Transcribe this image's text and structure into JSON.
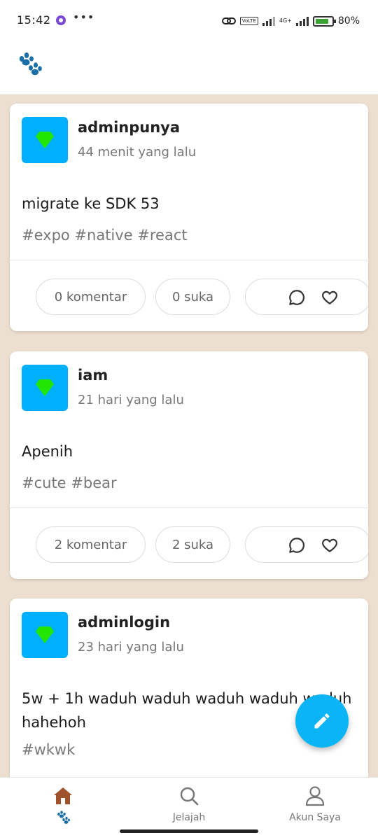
{
  "status_bar": {
    "time": "15:42",
    "more": "•••",
    "network": "4G+",
    "volte": "VoLTE",
    "battery": "80%"
  },
  "app_bar": {
    "logo_icon": "paw-icon",
    "brand_color": "#1b6fa8"
  },
  "posts": [
    {
      "username": "adminpunya",
      "time_ago": "44 menit yang lalu",
      "content": "migrate ke SDK 53",
      "tags": "#expo #native #react",
      "comments": "0 komentar",
      "likes": "0 suka"
    },
    {
      "username": "iam",
      "time_ago": "21 hari yang lalu",
      "content": "Apenih",
      "tags": "#cute #bear",
      "comments": "2 komentar",
      "likes": "2 suka"
    },
    {
      "username": "adminlogin",
      "time_ago": "23 hari yang lalu",
      "content": "5w + 1h waduh waduh waduh waduh waduh hahehoh",
      "tags": "#wkwk"
    }
  ],
  "fab": {
    "icon": "pencil-icon",
    "color": "#0ab4f5"
  },
  "tab_bar": {
    "tabs": [
      {
        "label": "",
        "icon": "home-icon",
        "active": true,
        "color": "#a0522d"
      },
      {
        "label": "Jelajah",
        "icon": "search-icon",
        "active": false
      },
      {
        "label": "Akun Saya",
        "icon": "user-icon",
        "active": false
      }
    ]
  },
  "colors": {
    "background": "#eddfd0",
    "avatar": "#00b0ff",
    "gem": "#22e600"
  }
}
